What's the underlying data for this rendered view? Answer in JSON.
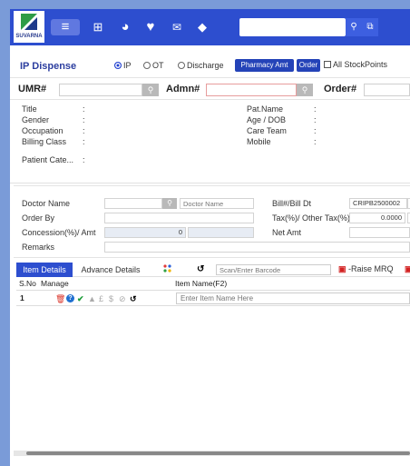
{
  "brand": {
    "name": "SUVARNA"
  },
  "nav": {
    "icons": [
      "menu-icon",
      "apps-grid-icon",
      "pie-chart-icon",
      "heart-icon",
      "mail-icon",
      "tag-icon"
    ],
    "search_placeholder": ""
  },
  "header": {
    "title": "IP Dispense",
    "radios": [
      {
        "label": "IP",
        "selected": true
      },
      {
        "label": "OT",
        "selected": false
      },
      {
        "label": "Discharge",
        "selected": false
      }
    ],
    "pharmacy_amt_label": "Pharmacy Amt",
    "order_label": "Order",
    "all_stockpoints_label": "All StockPoints"
  },
  "search_row": {
    "umr_label": "UMR#",
    "admn_label": "Admn#",
    "order_label": "Order#",
    "umr_value": "",
    "admn_value": "",
    "order_value": ""
  },
  "patient_info": {
    "left": [
      {
        "label": "Title",
        "value": ""
      },
      {
        "label": "Gender",
        "value": ""
      },
      {
        "label": "Occupation",
        "value": ""
      },
      {
        "label": "Billing Class",
        "value": ""
      },
      {
        "label": "Patient Cate...",
        "value": ""
      }
    ],
    "right": [
      {
        "label": "Pat.Name",
        "value": ""
      },
      {
        "label": "Age / DOB",
        "value": ""
      },
      {
        "label": "Care Team",
        "value": ""
      },
      {
        "label": "Mobile",
        "value": ""
      }
    ],
    "colon": ":"
  },
  "bill_form": {
    "doctor_name_label": "Doctor Name",
    "doctor_name_placeholder": "Doctor Name",
    "order_by_label": "Order By",
    "concession_label": "Concession(%)/ Amt",
    "concession_value": "0",
    "remarks_label": "Remarks",
    "bill_label": "Bill#/Bill Dt",
    "bill_value": "CRIPB2500002",
    "tax_label": "Tax(%)/ Other Tax(%)",
    "tax_value": "0.0000",
    "net_amt_label": "Net Amt"
  },
  "tabs": {
    "items": [
      "Item Details",
      "Advance Details"
    ],
    "active": 0,
    "scan_placeholder": "Scan/Enter Barcode",
    "raise_mrq_label": "-Raise MRQ"
  },
  "table": {
    "headers": [
      "S.No",
      "Manage",
      "Item Name(F2)"
    ],
    "rows": [
      {
        "sno": "1",
        "item_placeholder": "Enter Item Name Here"
      }
    ]
  },
  "colors": {
    "topbar": "#2d4ecf",
    "accent": "#2443b8",
    "frame": "#7a9bd8"
  }
}
